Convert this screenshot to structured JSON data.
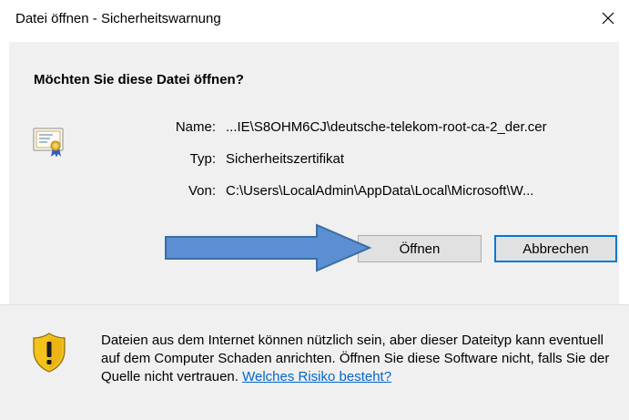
{
  "window": {
    "title": "Datei öffnen - Sicherheitswarnung",
    "close_glyph": "✕"
  },
  "dialog": {
    "question": "Möchten Sie diese Datei öffnen?",
    "fields": {
      "name_label": "Name:",
      "name_value": "...IE\\S8OHM6CJ\\deutsche-telekom-root-ca-2_der.cer",
      "type_label": "Typ:",
      "type_value": "Sicherheitszertifikat",
      "from_label": "Von:",
      "from_value": "C:\\Users\\LocalAdmin\\AppData\\Local\\Microsoft\\W..."
    },
    "buttons": {
      "open": "Öffnen",
      "cancel": "Abbrechen"
    }
  },
  "warning": {
    "text": "Dateien aus dem Internet können nützlich sein, aber dieser Dateityp kann eventuell auf dem Computer Schaden anrichten. Öffnen Sie diese Software nicht, falls Sie der Quelle nicht vertrauen. ",
    "link": "Welches Risiko besteht?"
  },
  "icons": {
    "certificate": "certificate-icon",
    "shield": "shield-warning-icon",
    "close": "close-icon",
    "arrow": "arrow-right-icon"
  },
  "colors": {
    "accent_blue": "#0078d7",
    "link_blue": "#0066cc",
    "arrow_fill": "#5b8fd2",
    "arrow_stroke": "#3a6ea5",
    "shield_yellow": "#f3c21b"
  }
}
